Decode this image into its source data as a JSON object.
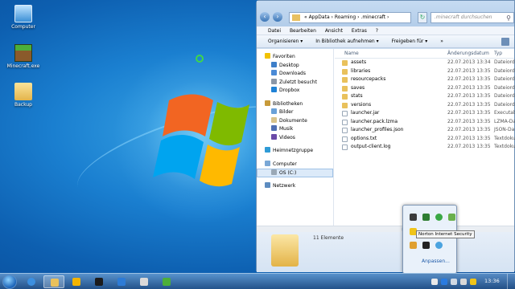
{
  "desktop": {
    "icons": [
      {
        "label": "Computer",
        "icon": "computer-icon"
      },
      {
        "label": "Minecraft.exe",
        "icon": "minecraft-icon"
      },
      {
        "label": "Backup",
        "icon": "folder-icon"
      }
    ]
  },
  "explorer": {
    "address_path": "« AppData › Roaming › .minecraft ›",
    "search_placeholder": ".minecraft durchsuchen",
    "menu": [
      "Datei",
      "Bearbeiten",
      "Ansicht",
      "Extras",
      "?"
    ],
    "toolbar": {
      "organize": "Organisieren ▾",
      "library": "In Bibliothek aufnehmen ▾",
      "share": "Freigeben für ▾",
      "more": "»"
    },
    "nav": {
      "favorites_header": "Favoriten",
      "favorites": [
        "Desktop",
        "Downloads",
        "Zuletzt besucht",
        "Dropbox"
      ],
      "libraries_header": "Bibliotheken",
      "libraries": [
        "Bilder",
        "Dokumente",
        "Musik",
        "Videos"
      ],
      "homegroup": "Heimnetzgruppe",
      "computer_header": "Computer",
      "drive": "OS (C:)",
      "network": "Netzwerk"
    },
    "columns": {
      "name": "Name",
      "date": "Änderungsdatum",
      "type": "Typ"
    },
    "files": [
      {
        "name": "assets",
        "date": "22.07.2013 13:34",
        "type": "Dateiord",
        "kind": "folder"
      },
      {
        "name": "libraries",
        "date": "22.07.2013 13:35",
        "type": "Dateiord",
        "kind": "folder"
      },
      {
        "name": "resourcepacks",
        "date": "22.07.2013 13:35",
        "type": "Dateiord",
        "kind": "folder"
      },
      {
        "name": "saves",
        "date": "22.07.2013 13:35",
        "type": "Dateiord",
        "kind": "folder"
      },
      {
        "name": "stats",
        "date": "22.07.2013 13:35",
        "type": "Dateiord",
        "kind": "folder"
      },
      {
        "name": "versions",
        "date": "22.07.2013 13:35",
        "type": "Dateiord",
        "kind": "folder"
      },
      {
        "name": "launcher.jar",
        "date": "22.07.2013 13:35",
        "type": "Executab",
        "kind": "file"
      },
      {
        "name": "launcher.pack.lzma",
        "date": "22.07.2013 13:35",
        "type": "LZMA-Da",
        "kind": "file"
      },
      {
        "name": "launcher_profiles.json",
        "date": "22.07.2013 13:35",
        "type": "JSON-Da",
        "kind": "file"
      },
      {
        "name": "options.txt",
        "date": "22.07.2013 13:35",
        "type": "Textdoku",
        "kind": "file"
      },
      {
        "name": "output-client.log",
        "date": "22.07.2013 13:35",
        "type": "Textdoku",
        "kind": "file"
      }
    ],
    "item_count": "11 Elemente"
  },
  "tray_flyout": {
    "tooltip": "Norton Internet Security",
    "customize_link": "Anpassen..."
  },
  "taskbar": {
    "clock": "13:36"
  },
  "colors": {
    "folder": "#e9c15c",
    "accent": "#1e5aa8"
  }
}
